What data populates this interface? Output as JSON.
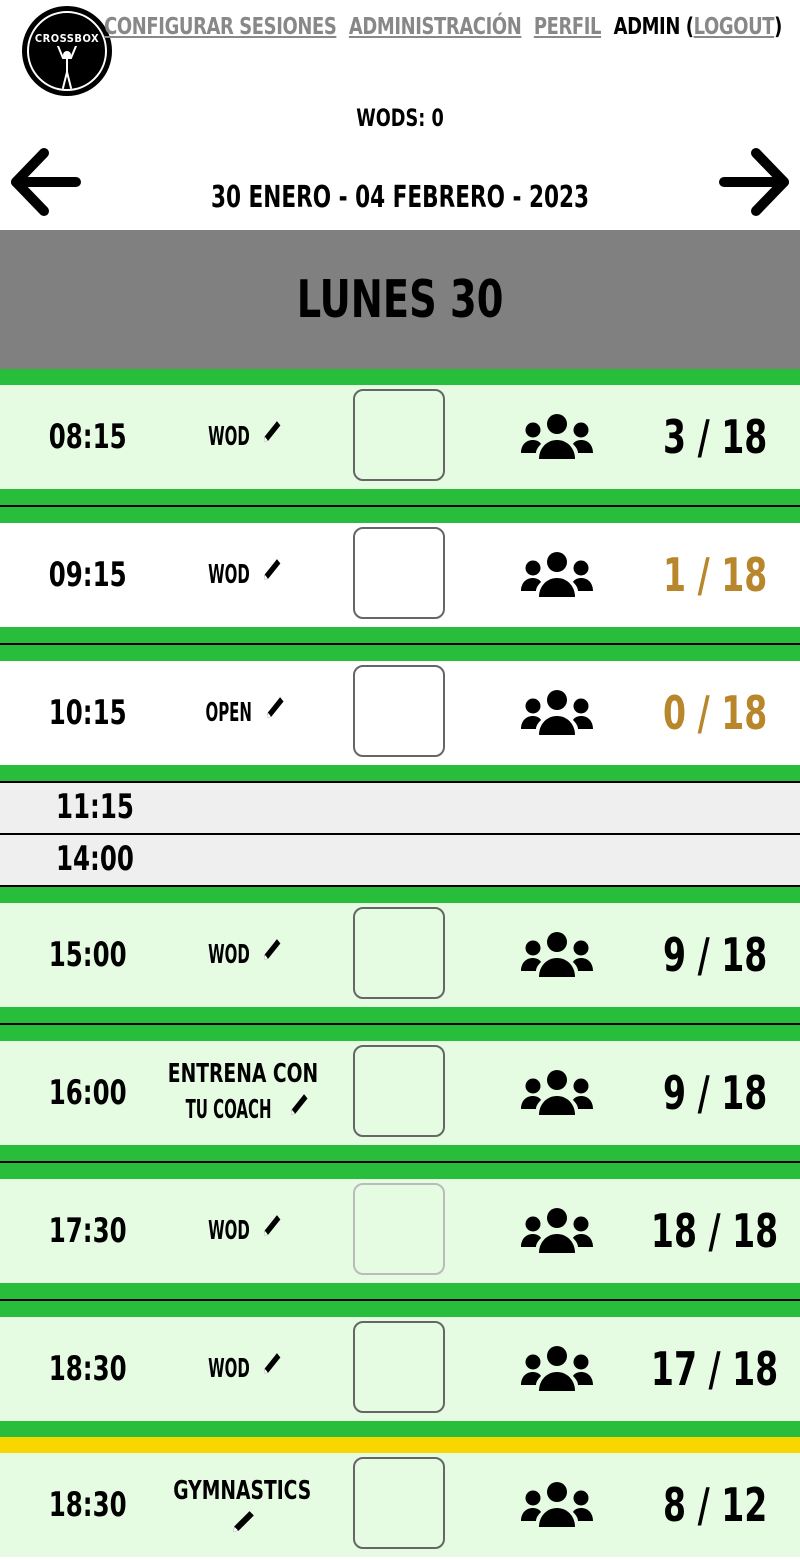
{
  "nav": {
    "configurar": "CONFIGURAR SESIONES",
    "administracion": "ADMINISTRACIÓN",
    "perfil": "PERFIL",
    "user": "ADMIN (",
    "logout": "LOGOUT",
    "close_paren": ")"
  },
  "logo": {
    "text": "CROSSBOX"
  },
  "wods": "WODS: 0",
  "week": "30 ENERO - 04 FEBRERO - 2023",
  "day": "LUNES 30",
  "colors": {
    "green_bar": "#28bd3b",
    "green_bg": "#e5fce3",
    "yellow_bar": "#f8d700",
    "gold_count": "#b8862b"
  },
  "sessions": [
    {
      "time": "08:15",
      "name": "WOD",
      "count": "3 / 18"
    },
    {
      "time": "09:15",
      "name": "WOD",
      "count": "1 / 18"
    },
    {
      "time": "10:15",
      "name": "OPEN",
      "count": "0 / 18"
    },
    {
      "time": "15:00",
      "name": "WOD",
      "count": "9 / 18"
    },
    {
      "time": "16:00",
      "name_line1": "ENTRENA CON",
      "name_line2": "TU COACH",
      "count": "9 / 18"
    },
    {
      "time": "17:30",
      "name": "WOD",
      "count": "18 / 18"
    },
    {
      "time": "18:30",
      "name": "WOD",
      "count": "17 / 18"
    },
    {
      "time": "18:30",
      "name": "GYMNASTICS",
      "count": "8 / 12"
    }
  ],
  "empty_slots": [
    "11:15",
    "14:00"
  ]
}
